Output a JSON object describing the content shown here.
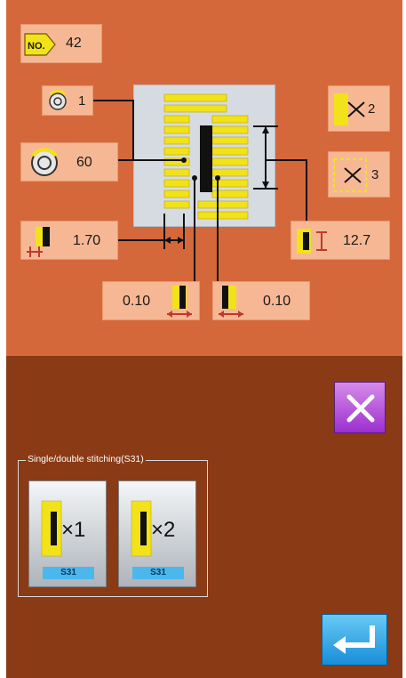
{
  "pattern": {
    "no_label": "NO.",
    "number": "42"
  },
  "params": {
    "tension_small": "1",
    "tension_large": "60",
    "width": "1.70",
    "offset_left": "0.10",
    "offset_right": "0.10",
    "length": "12.7",
    "stitch_mode_a": "2",
    "stitch_mode_b": "3"
  },
  "group": {
    "label": "Single/double stitching(S31)",
    "options": [
      {
        "glyph": "×1",
        "tag": "S31"
      },
      {
        "glyph": "×2",
        "tag": "S31"
      }
    ]
  },
  "colors": {
    "top_panel": "#d5683b",
    "bottom_panel": "#8a3a15",
    "yellow": "#f2e21a"
  }
}
